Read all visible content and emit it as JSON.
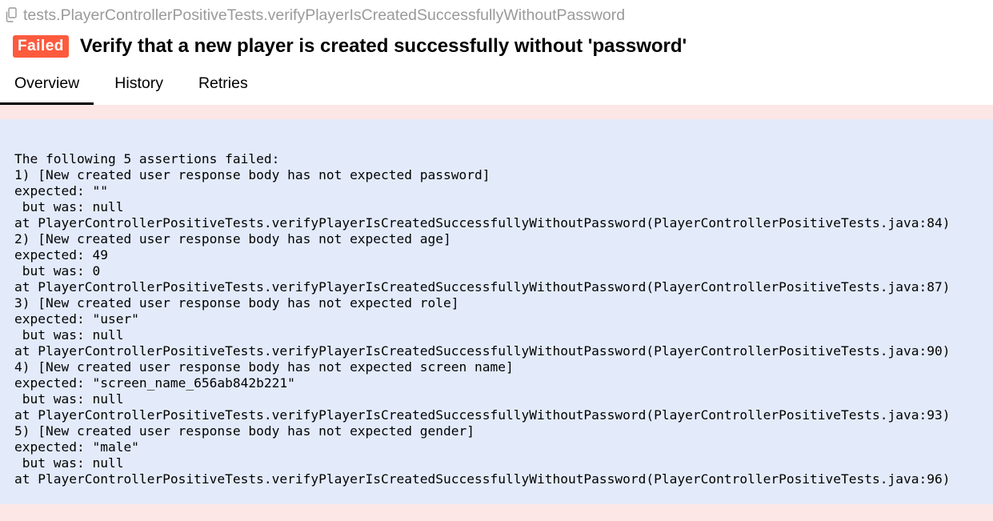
{
  "test": {
    "full_name": "tests.PlayerControllerPositiveTests.verifyPlayerIsCreatedSuccessfullyWithoutPassword",
    "status": "Failed",
    "title": "Verify that a new player is created successfully without 'password'"
  },
  "tabs": [
    {
      "label": "Overview",
      "active": true
    },
    {
      "label": "History",
      "active": false
    },
    {
      "label": "Retries",
      "active": false
    }
  ],
  "colors": {
    "failed_badge": "#fd5a3e",
    "error_background": "#e3ebfa",
    "failed_band": "#fde6e6"
  },
  "error": {
    "lines": [
      "The following 5 assertions failed:",
      "1) [New created user response body has not expected password]",
      "expected: \"\"",
      " but was: null",
      "at PlayerControllerPositiveTests.verifyPlayerIsCreatedSuccessfullyWithoutPassword(PlayerControllerPositiveTests.java:84)",
      "2) [New created user response body has not expected age]",
      "expected: 49",
      " but was: 0",
      "at PlayerControllerPositiveTests.verifyPlayerIsCreatedSuccessfullyWithoutPassword(PlayerControllerPositiveTests.java:87)",
      "3) [New created user response body has not expected role]",
      "expected: \"user\"",
      " but was: null",
      "at PlayerControllerPositiveTests.verifyPlayerIsCreatedSuccessfullyWithoutPassword(PlayerControllerPositiveTests.java:90)",
      "4) [New created user response body has not expected screen name]",
      "expected: \"screen_name_656ab842b221\"",
      " but was: null",
      "at PlayerControllerPositiveTests.verifyPlayerIsCreatedSuccessfullyWithoutPassword(PlayerControllerPositiveTests.java:93)",
      "5) [New created user response body has not expected gender]",
      "expected: \"male\"",
      " but was: null",
      "at PlayerControllerPositiveTests.verifyPlayerIsCreatedSuccessfullyWithoutPassword(PlayerControllerPositiveTests.java:96)"
    ]
  }
}
